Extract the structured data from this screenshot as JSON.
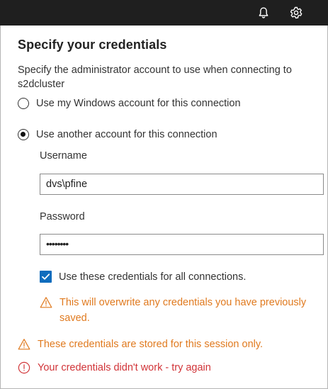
{
  "topbar": {
    "icons": [
      "bell-icon",
      "gear-icon"
    ]
  },
  "dialog": {
    "title": "Specify your credentials",
    "description": "Specify the administrator account to use when connecting to s2dcluster",
    "options": [
      {
        "label": "Use my Windows account for this connection",
        "selected": false
      },
      {
        "label": "Use another account for this connection",
        "selected": true
      }
    ],
    "username": {
      "label": "Username",
      "value": "dvs\\pfine"
    },
    "password": {
      "label": "Password",
      "value": "••••••••"
    },
    "use_for_all": {
      "label": "Use these credentials for all connections.",
      "checked": true
    },
    "overwrite_warning": "This will overwrite any credentials you have previously saved.",
    "session_warning": "These credentials are stored for this session only.",
    "error": "Your credentials didn't work - try again"
  },
  "colors": {
    "topbar": "#1f1f1f",
    "accent": "#0f6cbd",
    "warning": "#e07a1f",
    "error": "#d13438"
  }
}
